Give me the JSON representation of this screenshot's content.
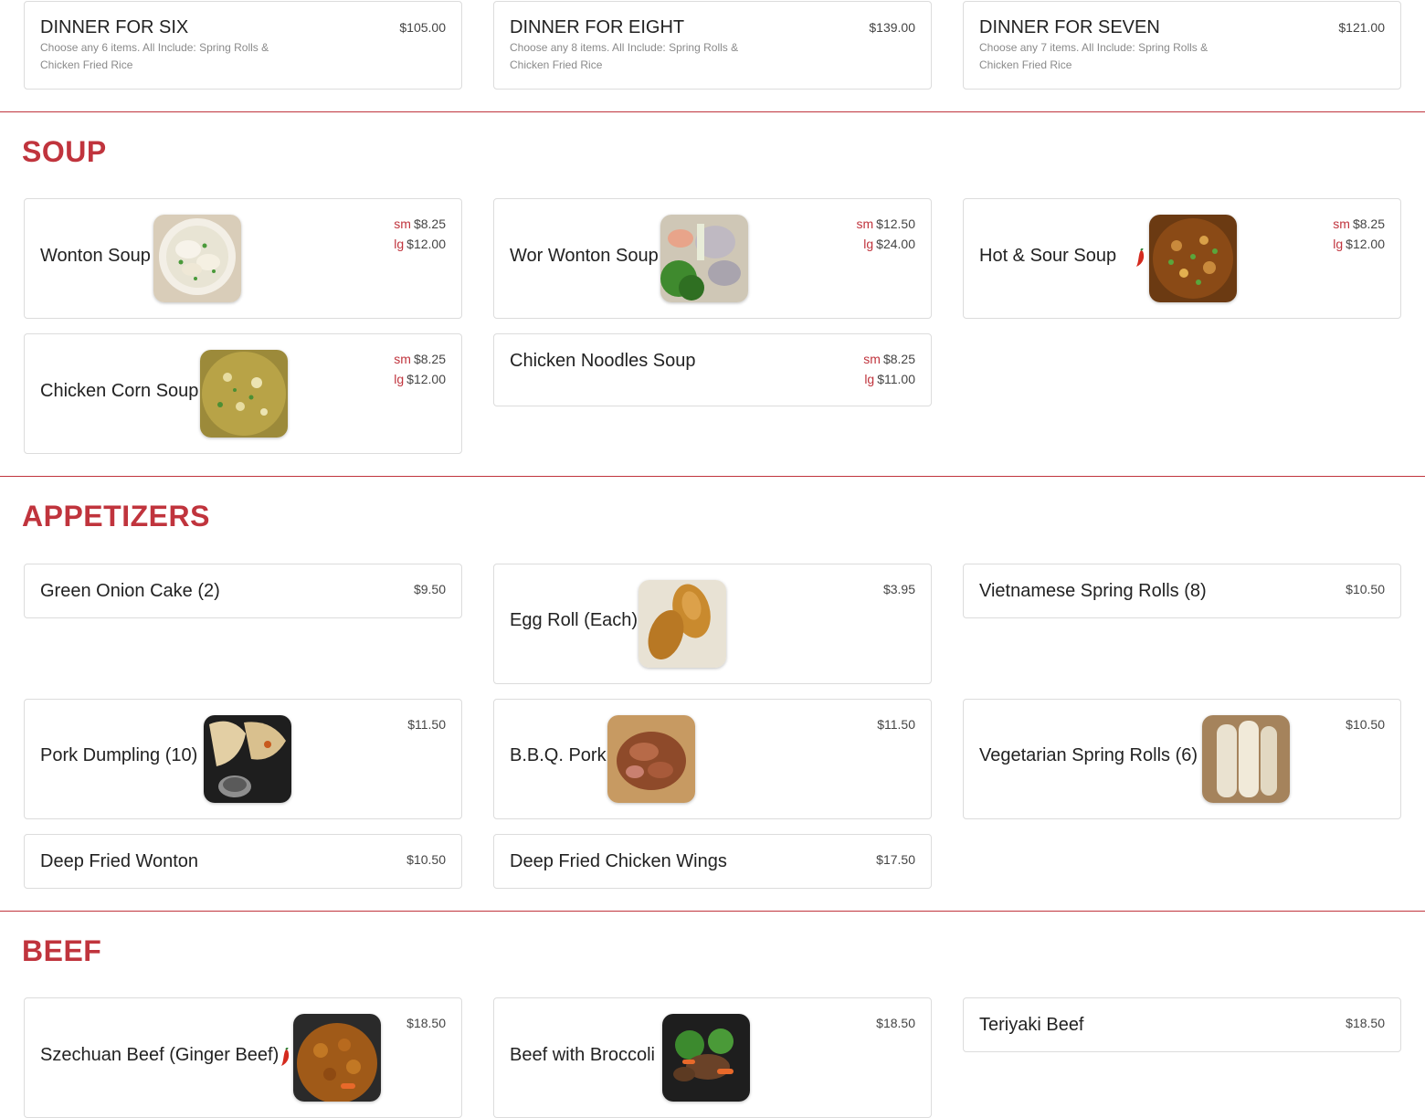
{
  "accent_color": "#c0343d",
  "dinners": [
    {
      "name": "DINNER FOR SIX",
      "price": "$105.00",
      "desc": "Choose any 6 items. All Include: Spring Rolls & Chicken Fried Rice"
    },
    {
      "name": "DINNER FOR EIGHT",
      "price": "$139.00",
      "desc": "Choose any 8 items. All Include: Spring Rolls & Chicken Fried Rice"
    },
    {
      "name": "DINNER FOR SEVEN",
      "price": "$121.00",
      "desc": "Choose any 7 items. All Include: Spring Rolls & Chicken Fried Rice"
    }
  ],
  "soup": {
    "title": "SOUP",
    "size_small": "sm",
    "size_large": "lg",
    "items": [
      {
        "name": "Wonton Soup",
        "sm": "$8.25",
        "lg": "$12.00",
        "image": "wonton-soup-photo"
      },
      {
        "name": "Wor Wonton Soup",
        "sm": "$12.50",
        "lg": "$24.00",
        "image": "wor-wonton-soup-photo"
      },
      {
        "name": "Hot & Sour Soup",
        "sm": "$8.25",
        "lg": "$12.00",
        "spicy": true,
        "image": "hot-sour-soup-photo"
      },
      {
        "name": "Chicken Corn Soup",
        "sm": "$8.25",
        "lg": "$12.00",
        "image": "chicken-corn-soup-photo"
      },
      {
        "name": "Chicken Noodles Soup",
        "sm": "$8.25",
        "lg": "$11.00"
      }
    ]
  },
  "appetizers": {
    "title": "APPETIZERS",
    "items": [
      {
        "name": "Green Onion Cake (2)",
        "price": "$9.50"
      },
      {
        "name": "Egg Roll (Each)",
        "price": "$3.95",
        "image": "egg-roll-photo"
      },
      {
        "name": "Vietnamese Spring Rolls (8)",
        "price": "$10.50"
      },
      {
        "name": "Pork Dumpling (10)",
        "price": "$11.50",
        "image": "pork-dumpling-photo"
      },
      {
        "name": "B.B.Q. Pork",
        "price": "$11.50",
        "image": "bbq-pork-photo"
      },
      {
        "name": "Vegetarian Spring Rolls (6)",
        "price": "$10.50",
        "image": "vegetarian-spring-rolls-photo"
      },
      {
        "name": "Deep Fried Wonton",
        "price": "$10.50"
      },
      {
        "name": "Deep Fried Chicken Wings",
        "price": "$17.50"
      }
    ]
  },
  "beef": {
    "title": "BEEF",
    "items": [
      {
        "name": "Szechuan Beef (Ginger Beef)",
        "price": "$18.50",
        "spicy": true,
        "image": "szechuan-beef-photo"
      },
      {
        "name": "Beef with Broccoli",
        "price": "$18.50",
        "image": "beef-broccoli-photo"
      },
      {
        "name": "Teriyaki Beef",
        "price": "$18.50"
      }
    ]
  }
}
